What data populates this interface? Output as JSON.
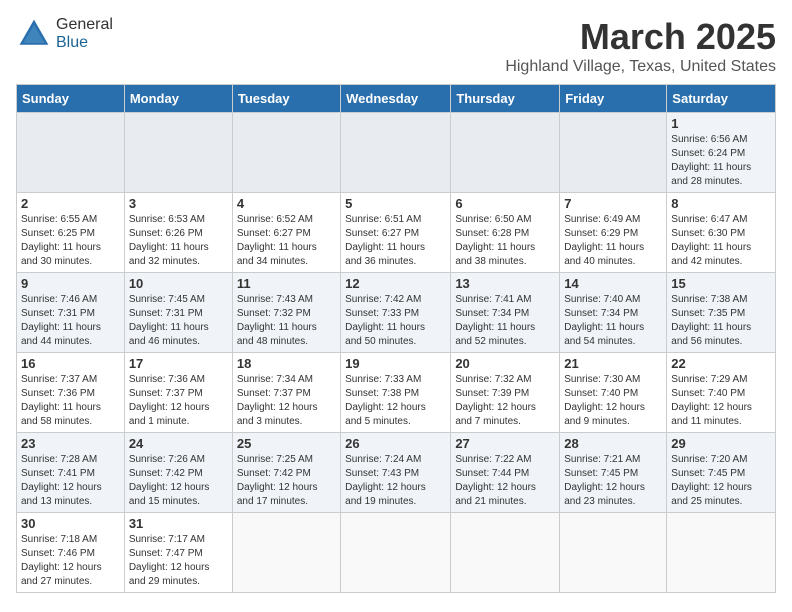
{
  "header": {
    "logo_general": "General",
    "logo_blue": "Blue",
    "title": "March 2025",
    "location": "Highland Village, Texas, United States"
  },
  "days_of_week": [
    "Sunday",
    "Monday",
    "Tuesday",
    "Wednesday",
    "Thursday",
    "Friday",
    "Saturday"
  ],
  "weeks": [
    [
      {
        "day": "",
        "info": ""
      },
      {
        "day": "",
        "info": ""
      },
      {
        "day": "",
        "info": ""
      },
      {
        "day": "",
        "info": ""
      },
      {
        "day": "",
        "info": ""
      },
      {
        "day": "",
        "info": ""
      },
      {
        "day": "1",
        "info": "Sunrise: 6:56 AM\nSunset: 6:24 PM\nDaylight: 11 hours\nand 28 minutes."
      }
    ],
    [
      {
        "day": "2",
        "info": "Sunrise: 6:55 AM\nSunset: 6:25 PM\nDaylight: 11 hours\nand 30 minutes."
      },
      {
        "day": "3",
        "info": "Sunrise: 6:53 AM\nSunset: 6:26 PM\nDaylight: 11 hours\nand 32 minutes."
      },
      {
        "day": "4",
        "info": "Sunrise: 6:52 AM\nSunset: 6:27 PM\nDaylight: 11 hours\nand 34 minutes."
      },
      {
        "day": "5",
        "info": "Sunrise: 6:51 AM\nSunset: 6:27 PM\nDaylight: 11 hours\nand 36 minutes."
      },
      {
        "day": "6",
        "info": "Sunrise: 6:50 AM\nSunset: 6:28 PM\nDaylight: 11 hours\nand 38 minutes."
      },
      {
        "day": "7",
        "info": "Sunrise: 6:49 AM\nSunset: 6:29 PM\nDaylight: 11 hours\nand 40 minutes."
      },
      {
        "day": "8",
        "info": "Sunrise: 6:47 AM\nSunset: 6:30 PM\nDaylight: 11 hours\nand 42 minutes."
      }
    ],
    [
      {
        "day": "9",
        "info": "Sunrise: 7:46 AM\nSunset: 7:31 PM\nDaylight: 11 hours\nand 44 minutes."
      },
      {
        "day": "10",
        "info": "Sunrise: 7:45 AM\nSunset: 7:31 PM\nDaylight: 11 hours\nand 46 minutes."
      },
      {
        "day": "11",
        "info": "Sunrise: 7:43 AM\nSunset: 7:32 PM\nDaylight: 11 hours\nand 48 minutes."
      },
      {
        "day": "12",
        "info": "Sunrise: 7:42 AM\nSunset: 7:33 PM\nDaylight: 11 hours\nand 50 minutes."
      },
      {
        "day": "13",
        "info": "Sunrise: 7:41 AM\nSunset: 7:34 PM\nDaylight: 11 hours\nand 52 minutes."
      },
      {
        "day": "14",
        "info": "Sunrise: 7:40 AM\nSunset: 7:34 PM\nDaylight: 11 hours\nand 54 minutes."
      },
      {
        "day": "15",
        "info": "Sunrise: 7:38 AM\nSunset: 7:35 PM\nDaylight: 11 hours\nand 56 minutes."
      }
    ],
    [
      {
        "day": "16",
        "info": "Sunrise: 7:37 AM\nSunset: 7:36 PM\nDaylight: 11 hours\nand 58 minutes."
      },
      {
        "day": "17",
        "info": "Sunrise: 7:36 AM\nSunset: 7:37 PM\nDaylight: 12 hours\nand 1 minute."
      },
      {
        "day": "18",
        "info": "Sunrise: 7:34 AM\nSunset: 7:37 PM\nDaylight: 12 hours\nand 3 minutes."
      },
      {
        "day": "19",
        "info": "Sunrise: 7:33 AM\nSunset: 7:38 PM\nDaylight: 12 hours\nand 5 minutes."
      },
      {
        "day": "20",
        "info": "Sunrise: 7:32 AM\nSunset: 7:39 PM\nDaylight: 12 hours\nand 7 minutes."
      },
      {
        "day": "21",
        "info": "Sunrise: 7:30 AM\nSunset: 7:40 PM\nDaylight: 12 hours\nand 9 minutes."
      },
      {
        "day": "22",
        "info": "Sunrise: 7:29 AM\nSunset: 7:40 PM\nDaylight: 12 hours\nand 11 minutes."
      }
    ],
    [
      {
        "day": "23",
        "info": "Sunrise: 7:28 AM\nSunset: 7:41 PM\nDaylight: 12 hours\nand 13 minutes."
      },
      {
        "day": "24",
        "info": "Sunrise: 7:26 AM\nSunset: 7:42 PM\nDaylight: 12 hours\nand 15 minutes."
      },
      {
        "day": "25",
        "info": "Sunrise: 7:25 AM\nSunset: 7:42 PM\nDaylight: 12 hours\nand 17 minutes."
      },
      {
        "day": "26",
        "info": "Sunrise: 7:24 AM\nSunset: 7:43 PM\nDaylight: 12 hours\nand 19 minutes."
      },
      {
        "day": "27",
        "info": "Sunrise: 7:22 AM\nSunset: 7:44 PM\nDaylight: 12 hours\nand 21 minutes."
      },
      {
        "day": "28",
        "info": "Sunrise: 7:21 AM\nSunset: 7:45 PM\nDaylight: 12 hours\nand 23 minutes."
      },
      {
        "day": "29",
        "info": "Sunrise: 7:20 AM\nSunset: 7:45 PM\nDaylight: 12 hours\nand 25 minutes."
      }
    ],
    [
      {
        "day": "30",
        "info": "Sunrise: 7:18 AM\nSunset: 7:46 PM\nDaylight: 12 hours\nand 27 minutes."
      },
      {
        "day": "31",
        "info": "Sunrise: 7:17 AM\nSunset: 7:47 PM\nDaylight: 12 hours\nand 29 minutes."
      },
      {
        "day": "",
        "info": ""
      },
      {
        "day": "",
        "info": ""
      },
      {
        "day": "",
        "info": ""
      },
      {
        "day": "",
        "info": ""
      },
      {
        "day": "",
        "info": ""
      }
    ]
  ]
}
